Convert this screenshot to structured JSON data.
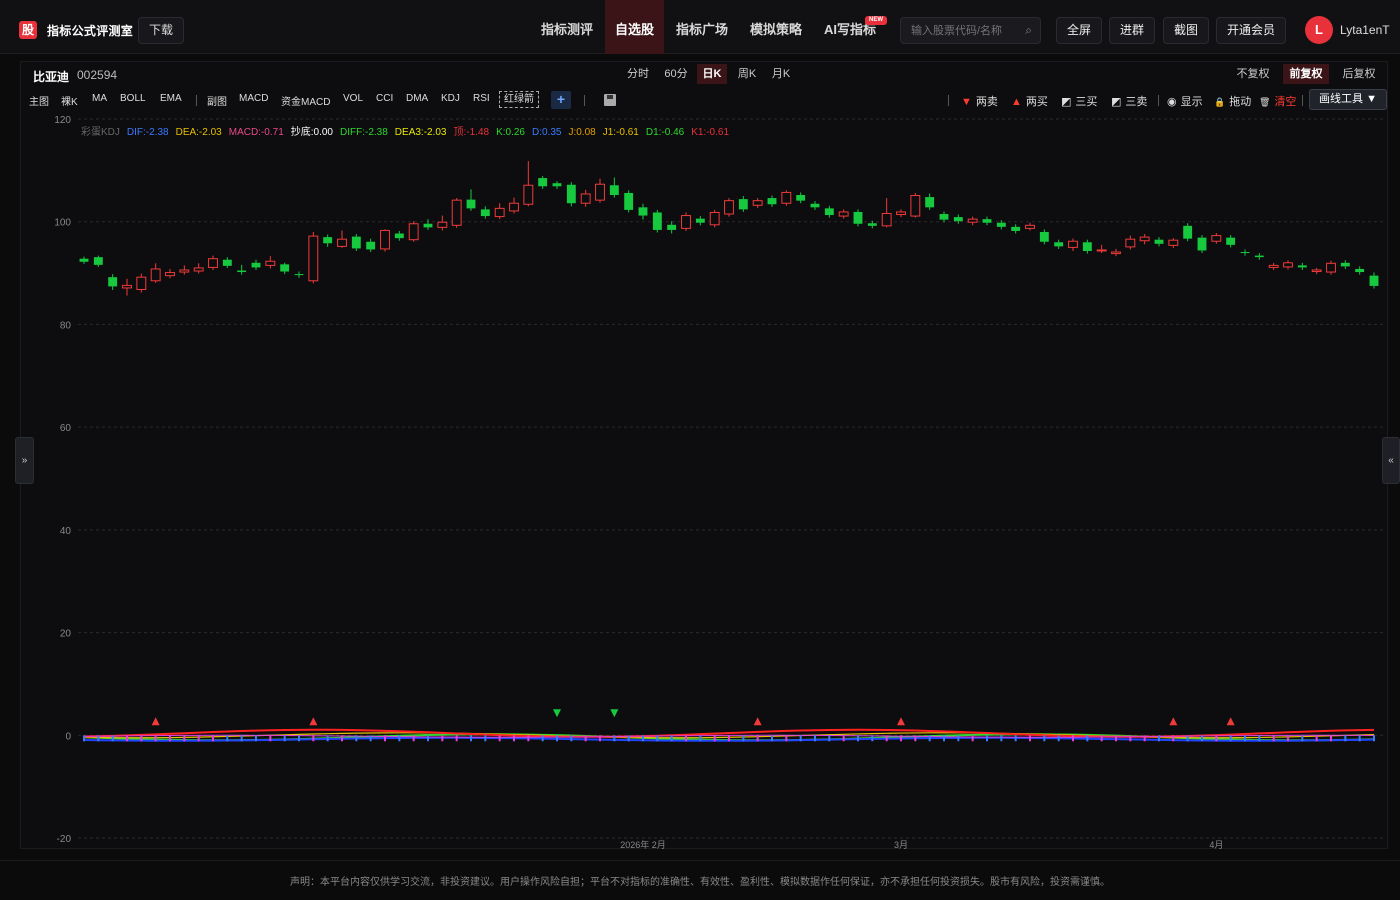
{
  "header": {
    "logo_char": "股",
    "brand": "指标公式评测室",
    "download_label": "下载",
    "nav": [
      {
        "label": "指标测评",
        "active": false
      },
      {
        "label": "自选股",
        "active": true
      },
      {
        "label": "指标广场",
        "active": false
      },
      {
        "label": "模拟策略",
        "active": false
      },
      {
        "label": "AI写指标",
        "active": false
      }
    ],
    "new_badge": "NEW",
    "search_placeholder": "输入股票代码/名称",
    "buttons": [
      "全屏",
      "进群",
      "截图",
      "开通会员"
    ],
    "avatar_letter": "L",
    "username": "Lyta1enT"
  },
  "stock": {
    "name": "比亚迪",
    "code": "002594"
  },
  "periods": [
    {
      "label": "分时",
      "active": false
    },
    {
      "label": "60分",
      "active": false
    },
    {
      "label": "日K",
      "active": true
    },
    {
      "label": "周K",
      "active": false
    },
    {
      "label": "月K",
      "active": false
    }
  ],
  "adjust": [
    {
      "label": "不复权",
      "active": false
    },
    {
      "label": "前复权",
      "active": true
    },
    {
      "label": "后复权",
      "active": false
    }
  ],
  "indicators_main": [
    "主图",
    "裸K",
    "MA",
    "BOLL",
    "EMA"
  ],
  "indicators_sub": [
    "副图",
    "MACD",
    "资金MACD",
    "VOL",
    "CCI",
    "DMA",
    "KDJ",
    "RSI"
  ],
  "hongluo_label": "红绿箭",
  "plus_label": "+",
  "tools": [
    {
      "glyph": "▼",
      "label": "两卖",
      "color": "#ff3b30"
    },
    {
      "glyph": "▲",
      "label": "两买",
      "color": "#ff3b30"
    },
    {
      "glyph": "◩",
      "label": "三买",
      "color": "#ddd"
    },
    {
      "glyph": "◩",
      "label": "三卖",
      "color": "#ddd"
    },
    {
      "glyph": "◉",
      "label": "显示",
      "color": "#ddd"
    },
    {
      "glyph": "🔒",
      "label": "拖动",
      "color": "#ddd"
    },
    {
      "glyph": "🗑",
      "label": "清空",
      "color": "#ff3b30"
    }
  ],
  "draw_tool_label": "画线工具 ▼",
  "legend": [
    {
      "text": "彩蛋KDJ",
      "color": "#666"
    },
    {
      "text": "DIF:-2.38",
      "color": "#3b7bff"
    },
    {
      "text": "DEA:-2.03",
      "color": "#e8c000"
    },
    {
      "text": "MACD:-0.71",
      "color": "#e84a8a"
    },
    {
      "text": "抄底:0.00",
      "color": "#ffffff"
    },
    {
      "text": "DIFF:-2.38",
      "color": "#2ed82e"
    },
    {
      "text": "DEA3:-2.03",
      "color": "#e8e800"
    },
    {
      "text": "顶:-1.48",
      "color": "#e8313a"
    },
    {
      "text": "K:0.26",
      "color": "#2ed82e"
    },
    {
      "text": "D:0.35",
      "color": "#3b7bff"
    },
    {
      "text": "J:0.08",
      "color": "#e8a000"
    },
    {
      "text": "J1:-0.61",
      "color": "#e8c000"
    },
    {
      "text": "D1:-0.46",
      "color": "#2ed82e"
    },
    {
      "text": "K1:-0.61",
      "color": "#e8313a"
    }
  ],
  "sidebar_left": "»",
  "sidebar_right": "«",
  "chart_data": {
    "type": "candlestick",
    "ylim": [
      -20,
      120
    ],
    "yticks": [
      120,
      100,
      80,
      60,
      40,
      20,
      0,
      -20
    ],
    "xticks": [
      {
        "index": 39,
        "label": "2026年 2月"
      },
      {
        "index": 57,
        "label": "3月"
      },
      {
        "index": 79,
        "label": "4月"
      }
    ],
    "grid": true,
    "candles": [
      [
        92.8,
        92.2,
        93.2,
        91.8
      ],
      [
        93.1,
        91.6,
        93.4,
        91.2
      ],
      [
        89.2,
        87.4,
        89.8,
        86.7
      ],
      [
        87.1,
        87.6,
        88.9,
        85.6
      ],
      [
        86.8,
        89.2,
        89.9,
        86.2
      ],
      [
        88.5,
        90.8,
        91.9,
        88.1
      ],
      [
        89.5,
        90.1,
        90.8,
        89.0
      ],
      [
        90.2,
        90.6,
        91.5,
        89.7
      ],
      [
        90.4,
        91.0,
        91.9,
        89.9
      ],
      [
        91.1,
        92.8,
        93.4,
        90.6
      ],
      [
        92.6,
        91.4,
        93.1,
        91.0
      ],
      [
        90.5,
        90.2,
        91.6,
        89.7
      ],
      [
        92.0,
        91.1,
        92.6,
        90.6
      ],
      [
        91.5,
        92.3,
        93.3,
        90.9
      ],
      [
        91.7,
        90.3,
        92.0,
        89.8
      ],
      [
        89.8,
        89.6,
        90.3,
        89.1
      ],
      [
        88.5,
        97.2,
        98.0,
        88.0
      ],
      [
        97.0,
        95.8,
        97.5,
        95.1
      ],
      [
        95.2,
        96.6,
        98.3,
        94.9
      ],
      [
        97.1,
        94.8,
        97.6,
        94.3
      ],
      [
        96.1,
        94.6,
        96.7,
        94.1
      ],
      [
        94.7,
        98.3,
        98.5,
        94.2
      ],
      [
        97.7,
        96.8,
        98.2,
        96.3
      ],
      [
        96.5,
        99.6,
        100.1,
        96.1
      ],
      [
        99.6,
        98.9,
        100.5,
        98.4
      ],
      [
        98.9,
        99.9,
        101.2,
        98.3
      ],
      [
        99.3,
        104.2,
        104.6,
        98.8
      ],
      [
        104.3,
        102.6,
        106.3,
        102.1
      ],
      [
        102.4,
        101.1,
        103.0,
        100.6
      ],
      [
        101.0,
        102.6,
        103.6,
        100.5
      ],
      [
        102.1,
        103.6,
        104.7,
        101.6
      ],
      [
        103.4,
        107.1,
        111.8,
        103.0
      ],
      [
        108.5,
        106.9,
        108.9,
        106.4
      ],
      [
        107.5,
        106.9,
        107.9,
        106.4
      ],
      [
        107.2,
        103.6,
        107.7,
        103.0
      ],
      [
        103.6,
        105.4,
        106.2,
        102.9
      ],
      [
        104.2,
        107.3,
        108.4,
        103.7
      ],
      [
        107.1,
        105.2,
        108.6,
        104.7
      ],
      [
        105.6,
        102.3,
        106.1,
        101.8
      ],
      [
        102.8,
        101.2,
        103.5,
        100.4
      ],
      [
        101.8,
        98.4,
        102.3,
        97.9
      ],
      [
        99.4,
        98.4,
        100.1,
        97.7
      ],
      [
        98.7,
        101.2,
        101.8,
        98.2
      ],
      [
        100.6,
        99.8,
        101.1,
        99.3
      ],
      [
        99.4,
        101.8,
        102.3,
        98.9
      ],
      [
        101.5,
        104.1,
        104.6,
        101.0
      ],
      [
        104.4,
        102.4,
        105.0,
        101.9
      ],
      [
        103.2,
        104.1,
        104.6,
        102.7
      ],
      [
        104.6,
        103.4,
        105.1,
        102.9
      ],
      [
        103.6,
        105.7,
        106.1,
        103.1
      ],
      [
        105.2,
        104.1,
        105.7,
        103.6
      ],
      [
        103.5,
        102.8,
        104.0,
        102.3
      ],
      [
        102.6,
        101.3,
        103.1,
        100.8
      ],
      [
        101.1,
        101.9,
        102.4,
        100.6
      ],
      [
        101.9,
        99.6,
        102.4,
        99.1
      ],
      [
        99.7,
        99.2,
        100.2,
        98.7
      ],
      [
        99.2,
        101.6,
        104.6,
        98.9
      ],
      [
        101.4,
        101.9,
        102.4,
        100.9
      ],
      [
        101.1,
        105.1,
        105.6,
        100.8
      ],
      [
        104.8,
        102.8,
        105.5,
        102.3
      ],
      [
        101.5,
        100.4,
        102.0,
        99.9
      ],
      [
        100.9,
        100.1,
        101.4,
        99.6
      ],
      [
        99.9,
        100.5,
        101.0,
        99.3
      ],
      [
        100.5,
        99.8,
        101.0,
        99.3
      ],
      [
        99.8,
        99.0,
        100.3,
        98.5
      ],
      [
        99.0,
        98.2,
        99.5,
        97.7
      ],
      [
        98.7,
        99.3,
        99.8,
        98.3
      ],
      [
        98.0,
        96.1,
        98.5,
        95.6
      ],
      [
        96.0,
        95.2,
        96.5,
        94.7
      ],
      [
        95.0,
        96.2,
        96.7,
        94.3
      ],
      [
        96.0,
        94.3,
        96.5,
        93.8
      ],
      [
        94.5,
        94.5,
        95.5,
        93.9
      ],
      [
        93.8,
        94.1,
        94.7,
        93.3
      ],
      [
        95.1,
        96.6,
        97.3,
        94.6
      ],
      [
        96.3,
        97.0,
        97.6,
        95.6
      ],
      [
        96.5,
        95.7,
        97.0,
        95.2
      ],
      [
        95.4,
        96.4,
        96.8,
        94.9
      ],
      [
        99.2,
        96.7,
        99.7,
        96.2
      ],
      [
        96.9,
        94.4,
        97.4,
        93.9
      ],
      [
        96.2,
        97.3,
        97.8,
        95.7
      ],
      [
        96.9,
        95.5,
        97.4,
        95.0
      ],
      [
        94.1,
        93.9,
        94.6,
        93.4
      ],
      [
        93.4,
        93.1,
        93.9,
        92.6
      ],
      [
        91.1,
        91.5,
        92.0,
        90.6
      ],
      [
        91.2,
        92.0,
        92.5,
        90.7
      ],
      [
        91.5,
        91.1,
        92.0,
        90.6
      ],
      [
        90.3,
        90.6,
        91.0,
        89.8
      ],
      [
        90.2,
        91.9,
        92.4,
        89.7
      ],
      [
        92.0,
        91.3,
        92.5,
        90.8
      ],
      [
        90.8,
        90.2,
        91.3,
        89.7
      ],
      [
        89.5,
        87.5,
        90.1,
        87.0
      ]
    ]
  },
  "footer": "声明：本平台内容仅供学习交流，非投资建议。用户操作风险自担；平台不对指标的准确性、有效性、盈利性、模拟数据作任何保证，亦不承担任何投资损失。股市有风险，投资需谨慎。"
}
